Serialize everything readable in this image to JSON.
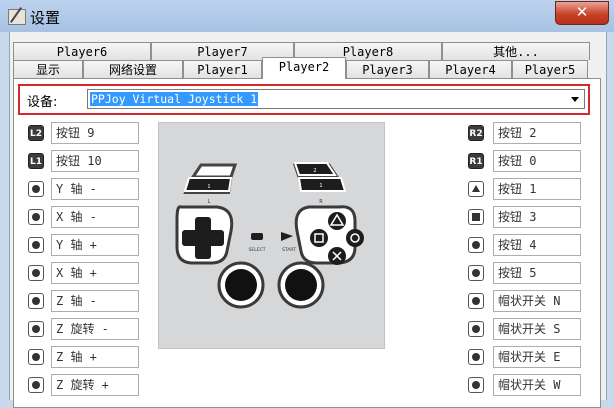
{
  "window": {
    "title": "设置",
    "close_glyph": "✕"
  },
  "tabs_row1": [
    {
      "label": "Player6"
    },
    {
      "label": "Player7"
    },
    {
      "label": "Player8"
    },
    {
      "label": "其他..."
    }
  ],
  "tabs_row2": [
    {
      "label": "显示",
      "active": false
    },
    {
      "label": "网络设置",
      "active": false
    },
    {
      "label": "Player1",
      "active": false
    },
    {
      "label": "Player2",
      "active": true
    },
    {
      "label": "Player3",
      "active": false
    },
    {
      "label": "Player4",
      "active": false
    },
    {
      "label": "Player5",
      "active": false
    }
  ],
  "device": {
    "label": "设备:",
    "selected": "PPJoy Virtual Joystick 1"
  },
  "left_bindings": [
    {
      "icon": "L2",
      "icon_name": "l2-button-icon",
      "value": "按钮 9"
    },
    {
      "icon": "L1",
      "icon_name": "l1-button-icon",
      "value": "按钮 10"
    },
    {
      "icon": "",
      "icon_name": "dpad-up-icon",
      "value": "Y 轴 -"
    },
    {
      "icon": "",
      "icon_name": "dpad-left-icon",
      "value": "X 轴 -"
    },
    {
      "icon": "",
      "icon_name": "dpad-down-icon",
      "value": "Y 轴 +"
    },
    {
      "icon": "",
      "icon_name": "dpad-right-icon",
      "value": "X 轴 +"
    },
    {
      "icon": "",
      "icon_name": "left-stick-up-icon",
      "value": "Z 轴 -"
    },
    {
      "icon": "",
      "icon_name": "left-stick-left-icon",
      "value": "Z 旋转 -"
    },
    {
      "icon": "",
      "icon_name": "left-stick-down-icon",
      "value": "Z 轴 +"
    },
    {
      "icon": "",
      "icon_name": "left-stick-right-icon",
      "value": "Z 旋转 +"
    }
  ],
  "right_bindings": [
    {
      "icon": "R2",
      "icon_name": "r2-button-icon",
      "value": "按钮 2"
    },
    {
      "icon": "R1",
      "icon_name": "r1-button-icon",
      "value": "按钮 0"
    },
    {
      "icon": "",
      "icon_name": "triangle-button-icon",
      "value": "按钮 1"
    },
    {
      "icon": "",
      "icon_name": "square-button-icon",
      "value": "按钮 3"
    },
    {
      "icon": "",
      "icon_name": "cross-button-icon",
      "value": "按钮 4"
    },
    {
      "icon": "",
      "icon_name": "circle-button-icon",
      "value": "按钮 5"
    },
    {
      "icon": "",
      "icon_name": "right-stick-up-icon",
      "value": "帽状开关 N"
    },
    {
      "icon": "",
      "icon_name": "right-stick-left-icon",
      "value": "帽状开关 S"
    },
    {
      "icon": "",
      "icon_name": "right-stick-down-icon",
      "value": "帽状开关 E"
    },
    {
      "icon": "",
      "icon_name": "right-stick-right-icon",
      "value": "帽状开关 W"
    }
  ],
  "pad": {
    "select_label": "SELECT",
    "start_label": "START",
    "l_label": "L",
    "r_label": "R"
  },
  "colors": {
    "selection": "#3399ff",
    "highlight_border": "#d42a2a"
  }
}
